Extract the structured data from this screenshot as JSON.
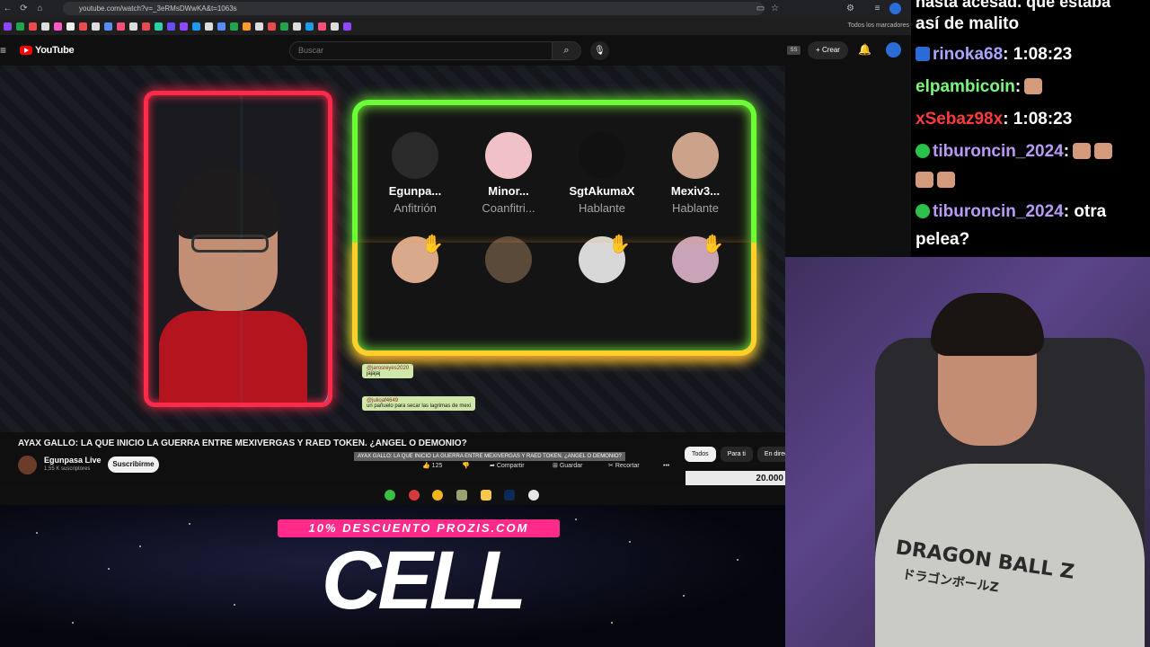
{
  "browser": {
    "url": "youtube.com/watch?v=_3eRMsDWwKA&t=1063s",
    "all_bookmarks": "Todos los marcadores"
  },
  "youtube": {
    "logo": "YouTube",
    "search_placeholder": "Buscar",
    "create_label": "Crear",
    "hd_badge": "SS"
  },
  "video": {
    "speakers": [
      {
        "name": "Egunpa...",
        "role": "Anfitrión",
        "color": "#2a2a2a"
      },
      {
        "name": "Minor...",
        "role": "Coanfitri...",
        "color": "#f0c2c8"
      },
      {
        "name": "SgtAkumaX",
        "role": "Hablante",
        "color": "#111111"
      },
      {
        "name": "Mexiv3...",
        "role": "Hablante",
        "color": "#caa38a"
      }
    ],
    "listeners": [
      {
        "color": "#d9a98c"
      },
      {
        "color": "#5a4a3a"
      },
      {
        "color": "#d8d8d8"
      },
      {
        "color": "#c9a3b8"
      }
    ],
    "chat_overlay": [
      {
        "user": "@jarosreyes2020",
        "text": "jajajaj"
      },
      {
        "user": "@julioaf4649",
        "text": "un pañuelo para secar las lagrimas de mexi"
      }
    ]
  },
  "watch": {
    "title": "AYAX GALLO: LA QUE INICIO LA GUERRA ENTRE MEXIVERGAS Y RAED TOKEN. ¿ANGEL O DEMONIO?",
    "tooltip": "AYAX GALLO: LA QUE INICIO LA GUERRA ENTRE MEXIVERGAS Y RAED TOKEN. ¿ANGEL O DEMONIO?",
    "channel": "Egunpasa Live",
    "subscribers": "1,55 K suscriptores",
    "subscribe_label": "Suscribirme",
    "likes": "125",
    "share": "Compartir",
    "save": "Guardar",
    "clip": "Recortar",
    "chips": [
      "Todos",
      "Para ti",
      "En direc"
    ],
    "thumb_text": "20.000"
  },
  "promo": {
    "banner": "10% DESCUENTO PROZIS.COM",
    "big_text": "CELL"
  },
  "twitch_chat": [
    {
      "user": "",
      "text": "hasta ácesad. que estaba",
      "color": "#ffffff"
    },
    {
      "user": "",
      "text": "así de malito",
      "color": "#ffffff"
    },
    {
      "user": "rinoka68",
      "text": ": 1:08:23",
      "color": "#a9a6ff"
    },
    {
      "user": "elpambicoin",
      "text": ":",
      "color": "#7af77a"
    },
    {
      "user": "xSebaz98x",
      "text": ": 1:08:23",
      "color": "#ff3b3b"
    },
    {
      "user": "tiburoncin_2024",
      "text": ":",
      "color": "#b99af5"
    },
    {
      "user": "tiburoncin_2024",
      "text": ": otra",
      "color": "#b99af5"
    },
    {
      "user": "",
      "text": "pelea?",
      "color": "#ffffff"
    }
  ],
  "webcam": {
    "hoodie_text": "DRAGON BALL Z",
    "hoodie_jp": "ドラゴンボールZ"
  }
}
